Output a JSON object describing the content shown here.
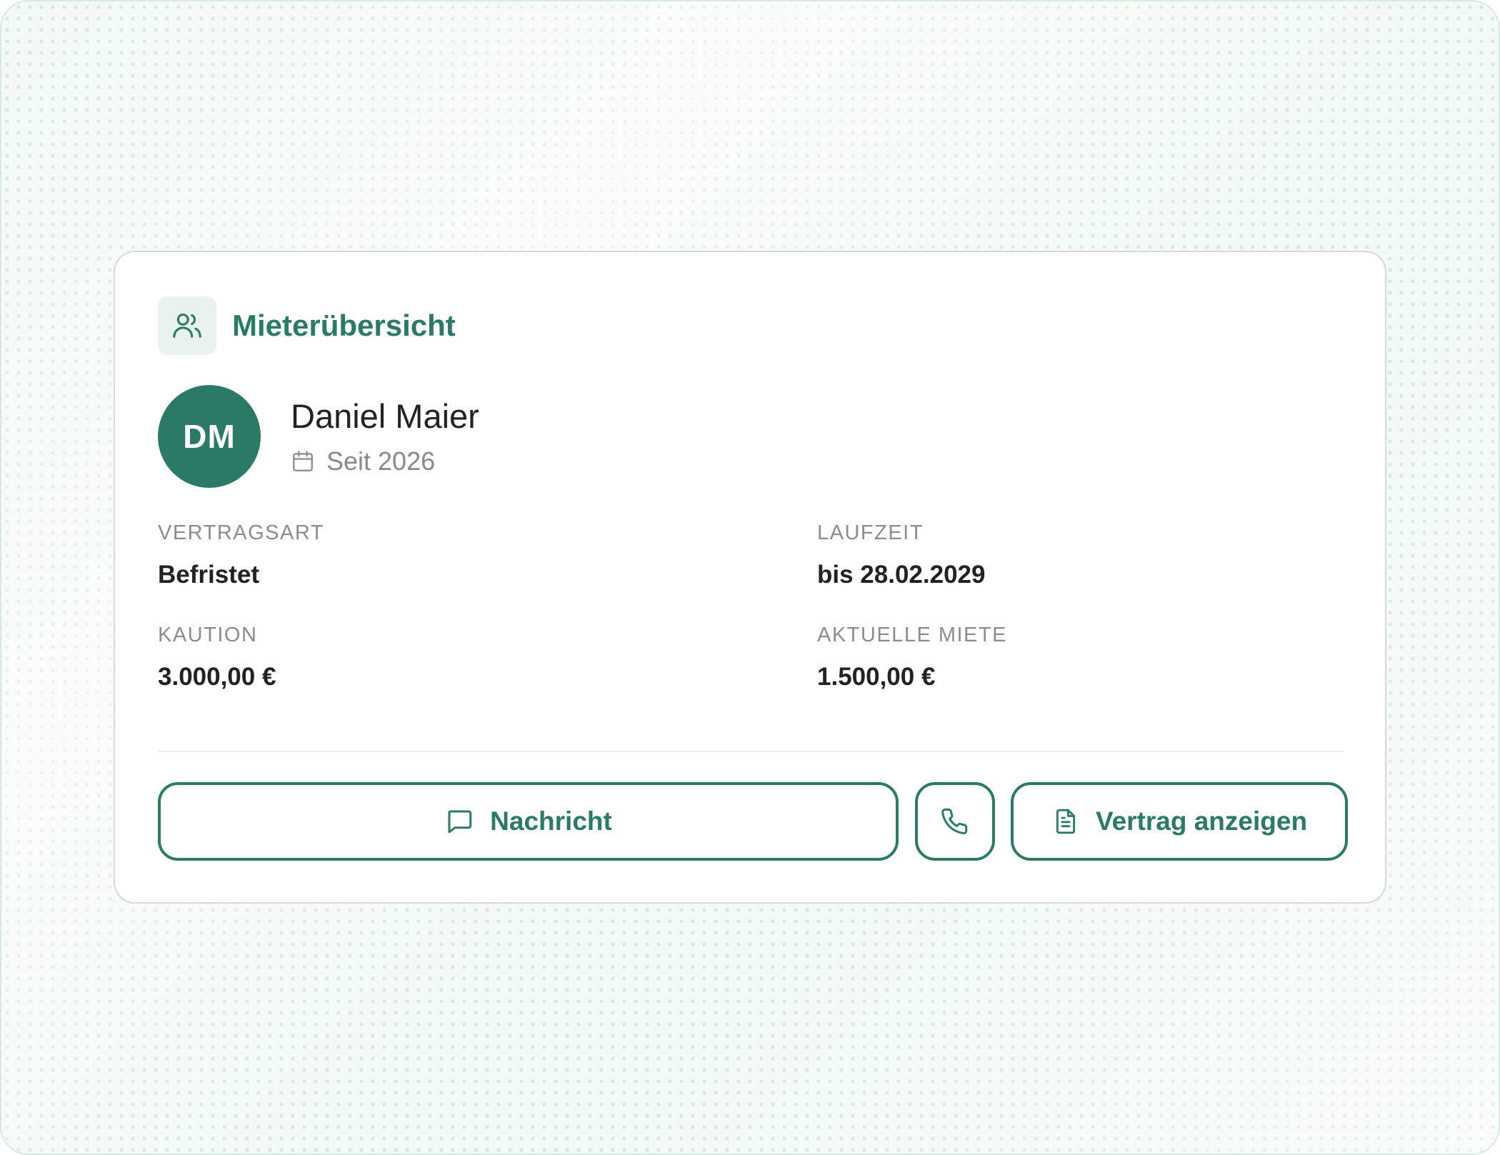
{
  "card": {
    "title": "Mieterübersicht",
    "header_icon": "users-icon"
  },
  "tenant": {
    "initials": "DM",
    "name": "Daniel Maier",
    "since": "Seit 2026",
    "since_icon": "calendar-icon"
  },
  "fields": {
    "contract_type": {
      "label": "VERTRAGSART",
      "value": "Befristet"
    },
    "term": {
      "label": "LAUFZEIT",
      "value": "bis 28.02.2029"
    },
    "deposit": {
      "label": "KAUTION",
      "value": "3.000,00 €"
    },
    "current_rent": {
      "label": "AKTUELLE MIETE",
      "value": "1.500,00 €"
    }
  },
  "actions": {
    "message": {
      "label": "Nachricht",
      "icon": "message-square-icon"
    },
    "call": {
      "icon": "phone-icon"
    },
    "contract": {
      "label": "Vertrag anzeigen",
      "icon": "file-text-icon"
    }
  },
  "colors": {
    "accent": "#2a7a67",
    "accent_soft": "#eaf2ee",
    "text_primary": "#222222",
    "text_muted": "#8c8c8c"
  }
}
